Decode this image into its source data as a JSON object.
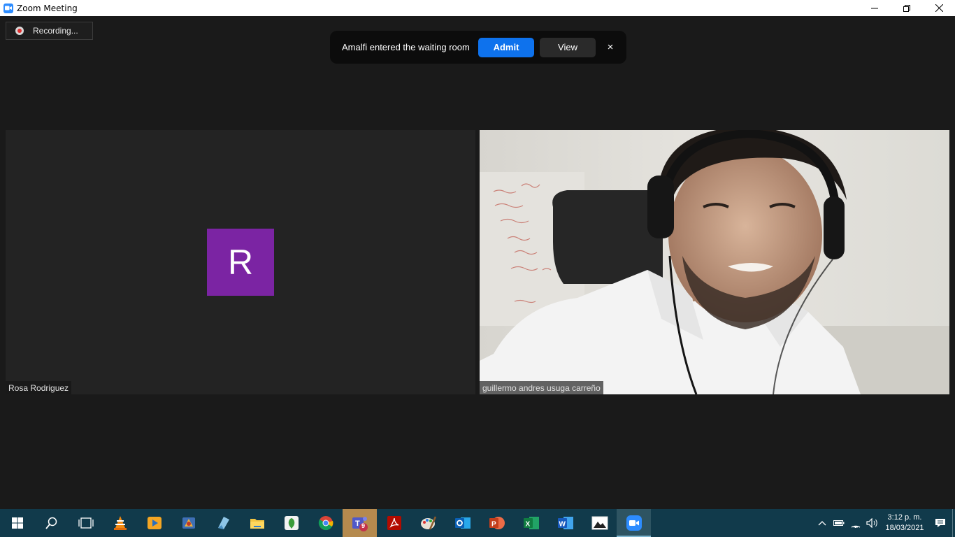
{
  "window": {
    "title": "Zoom Meeting"
  },
  "meeting": {
    "recording_label": "Recording...",
    "notification": {
      "message": "Amalfi entered the waiting room",
      "admit_label": "Admit",
      "view_label": "View",
      "close_label": "×"
    },
    "participants": [
      {
        "name": "Rosa Rodriguez",
        "avatar_letter": "R",
        "avatar_color": "#7b24a3",
        "video": false
      },
      {
        "name": "guillermo andres usuga carreño",
        "video": true
      }
    ]
  },
  "taskbar": {
    "apps": [
      "start-icon",
      "search-icon",
      "task-view-icon",
      "vlc-icon",
      "media-player-icon",
      "app-icon",
      "notes-icon",
      "file-explorer-icon",
      "app-green-icon",
      "chrome-icon",
      "teams-icon",
      "acrobat-icon",
      "paint-icon",
      "outlook-icon",
      "powerpoint-icon",
      "excel-icon",
      "word-icon",
      "photos-icon",
      "zoom-icon"
    ],
    "teams_badge": "9",
    "clock": {
      "time": "3:12 p. m.",
      "date": "18/03/2021"
    }
  },
  "colors": {
    "accent": "#0e72ed",
    "taskbar": "#113a4b",
    "background": "#1a1a1a"
  }
}
